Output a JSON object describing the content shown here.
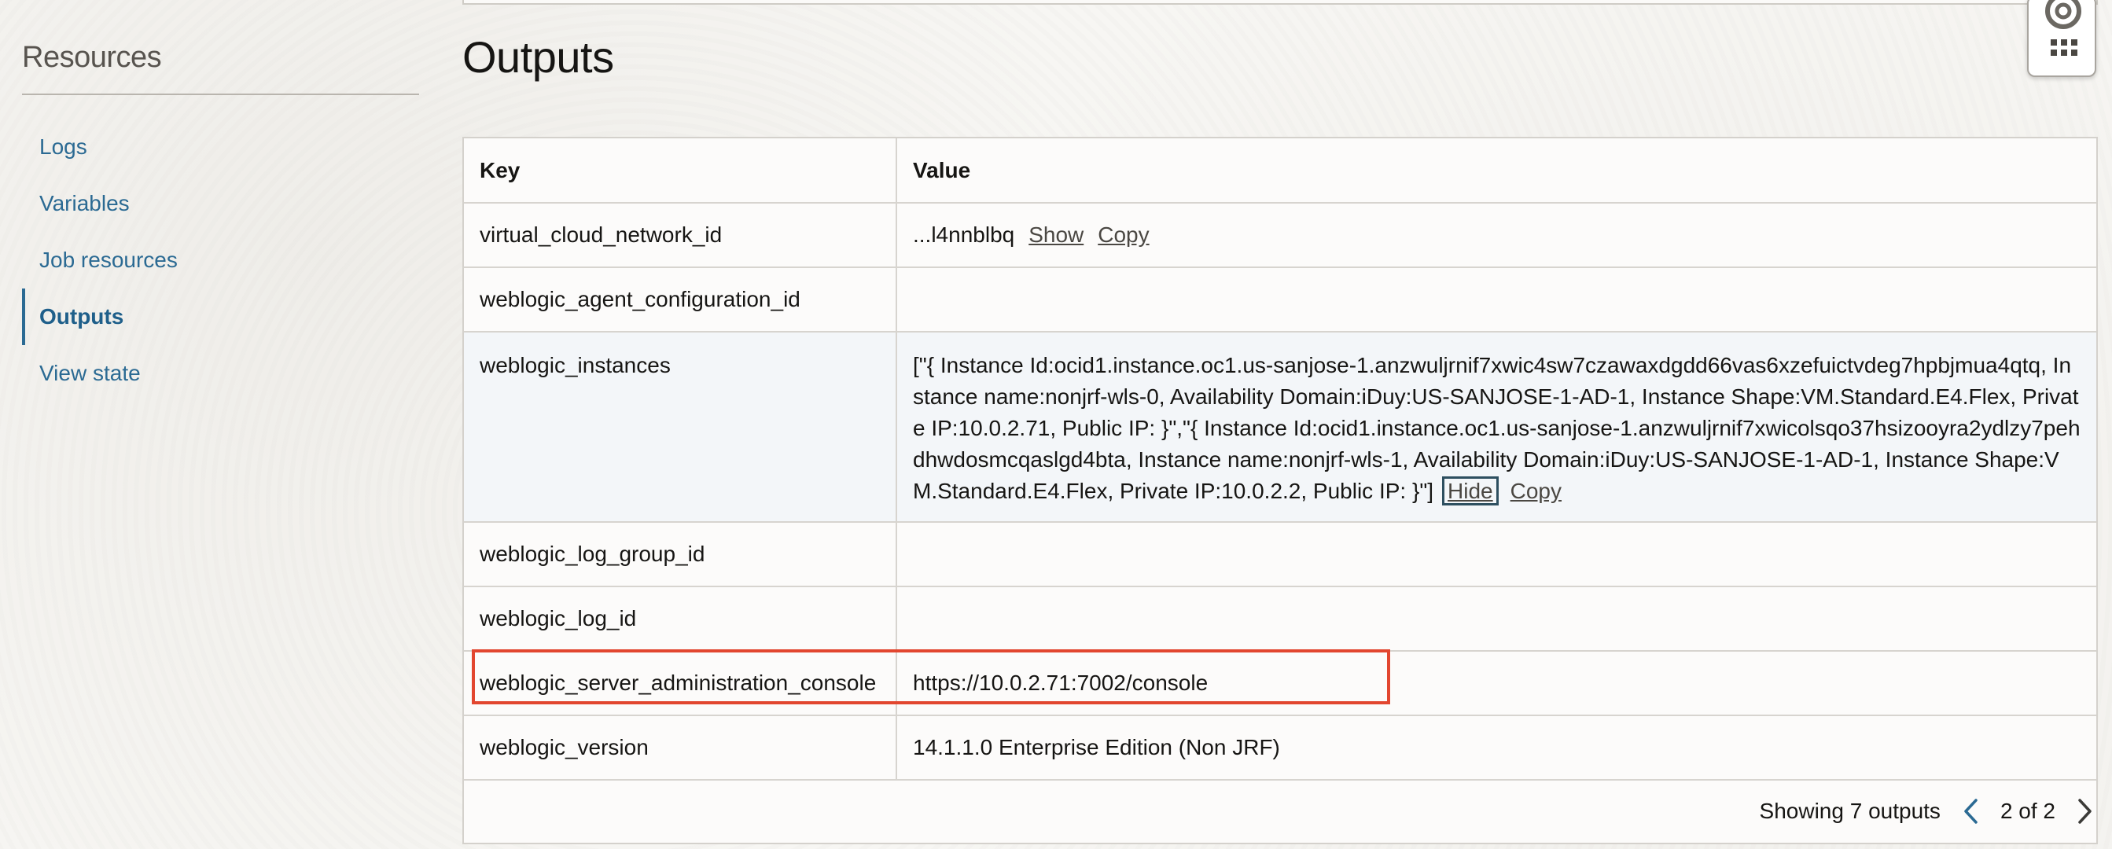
{
  "sidebar": {
    "title": "Resources",
    "items": [
      {
        "label": "Logs",
        "active": false
      },
      {
        "label": "Variables",
        "active": false
      },
      {
        "label": "Job resources",
        "active": false
      },
      {
        "label": "Outputs",
        "active": true
      },
      {
        "label": "View state",
        "active": false
      }
    ]
  },
  "main": {
    "title": "Outputs",
    "table": {
      "headers": {
        "key": "Key",
        "value": "Value"
      },
      "rows": [
        {
          "key": "virtual_cloud_network_id",
          "value": "...l4nnblbq",
          "actions": [
            "Show",
            "Copy"
          ]
        },
        {
          "key": "weblogic_agent_configuration_id",
          "value": ""
        },
        {
          "key": "weblogic_instances",
          "value": "[\"{ Instance Id:ocid1.instance.oc1.us-sanjose-1.anzwuljrnif7xwic4sw7czawaxdgdd66vas6xzefuictvdeg7hpbjmua4qtq, Instance name:nonjrf-wls-0, Availability Domain:iDuy:US-SANJOSE-1-AD-1, Instance Shape:VM.Standard.E4.Flex, Private IP:10.0.2.71, Public IP: }\",\"{ Instance Id:ocid1.instance.oc1.us-sanjose-1.anzwuljrnif7xwicolsqo37hsizooyra2ydlzy7pehdhwdosmcqaslgd4bta, Instance name:nonjrf-wls-1, Availability Domain:iDuy:US-SANJOSE-1-AD-1, Instance Shape:VM.Standard.E4.Flex, Private IP:10.0.2.2, Public IP: }\"]",
          "actions": [
            "Hide",
            "Copy"
          ]
        },
        {
          "key": "weblogic_log_group_id",
          "value": ""
        },
        {
          "key": "weblogic_log_id",
          "value": ""
        },
        {
          "key": "weblogic_server_administration_console",
          "value": "https://10.0.2.71:7002/console"
        },
        {
          "key": "weblogic_version",
          "value": "14.1.1.0 Enterprise Edition (Non JRF)"
        }
      ]
    },
    "footer": {
      "showing": "Showing 7 outputs",
      "page": "2 of 2"
    }
  },
  "colors": {
    "link": "#2b6a93",
    "highlight_box": "#e2462f",
    "row_highlight": "#f3f6f9"
  },
  "icons": {
    "prev": "chevron-left-icon",
    "next": "chevron-right-icon",
    "help": "lifebuoy-icon",
    "apps": "grid-icon"
  }
}
